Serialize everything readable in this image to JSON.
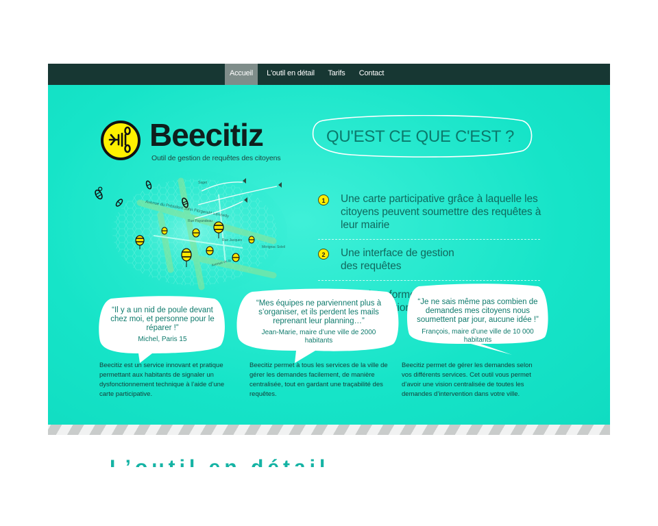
{
  "nav": {
    "items": [
      {
        "label": "Accueil",
        "active": true
      },
      {
        "label": "L'outil en détail",
        "active": false
      },
      {
        "label": "Tarifs",
        "active": false
      },
      {
        "label": "Contact",
        "active": false
      }
    ]
  },
  "brand": {
    "name": "Beecitiz",
    "tagline": "Outil de gestion de requêtes des citoyens",
    "logo_icon": "bee-logo-icon"
  },
  "map": {
    "street_labels": [
      "Avenue du Président John Fitzgerald Kennedy",
      "Rue Payandeau",
      "Rue Jacques",
      "Mérignac Soleil",
      "Avenue de la",
      "Saget"
    ],
    "icons": [
      "bee-icon",
      "map-pin-icon"
    ]
  },
  "intro": {
    "heading": "QU'EST CE QUE C'EST ?",
    "features": [
      {
        "num": "1",
        "text": "Une carte participative grâce à laquelle les citoyens peuvent soumettre des requêtes à leur mairie"
      },
      {
        "num": "2",
        "text": "Une interface de gestion des requêtes"
      },
      {
        "num": "3",
        "text": "Une plate-forme d’organisation et de communication interservices"
      }
    ]
  },
  "testimonials": [
    {
      "quote": "“Il y a un nid de poule devant chez moi, et personne pour le réparer !”",
      "author": "Michel, Paris 15"
    },
    {
      "quote": "“Mes équipes ne parviennent plus à s’organiser, et ils perdent les mails reprenant leur planning…”",
      "author": "Jean-Marie, maire d’une ville de 2000 habitants"
    },
    {
      "quote": "“Je ne sais même pas combien de demandes mes citoyens nous soumettent par jour, aucune idée !”",
      "author": "François, maire d’une ville de 10 000 habitants"
    }
  ],
  "descriptions": [
    "Beecitiz est un service innovant et pratique permettant aux habitants de signaler un dysfonctionnement technique à l’aide d’une carte participative.",
    "Beecitiz permet à tous les services de la ville de gérer les demandes facilement, de manière centralisée, tout en gardant une traçabilité des requêtes.",
    "Beecitiz permet de gérer les demandes selon vos différents services. Cet outil vous permet d’avoir une vision centralisée de toutes les demandes d’intervention dans votre ville."
  ],
  "below_fold": {
    "heading_partial": "L’outil en détail"
  },
  "colors": {
    "nav_bg": "#173733",
    "nav_active": "#7f8d8a",
    "hero_bg": "#16e4c8",
    "accent_yellow": "#ffee00",
    "text_teal": "#10685d"
  }
}
